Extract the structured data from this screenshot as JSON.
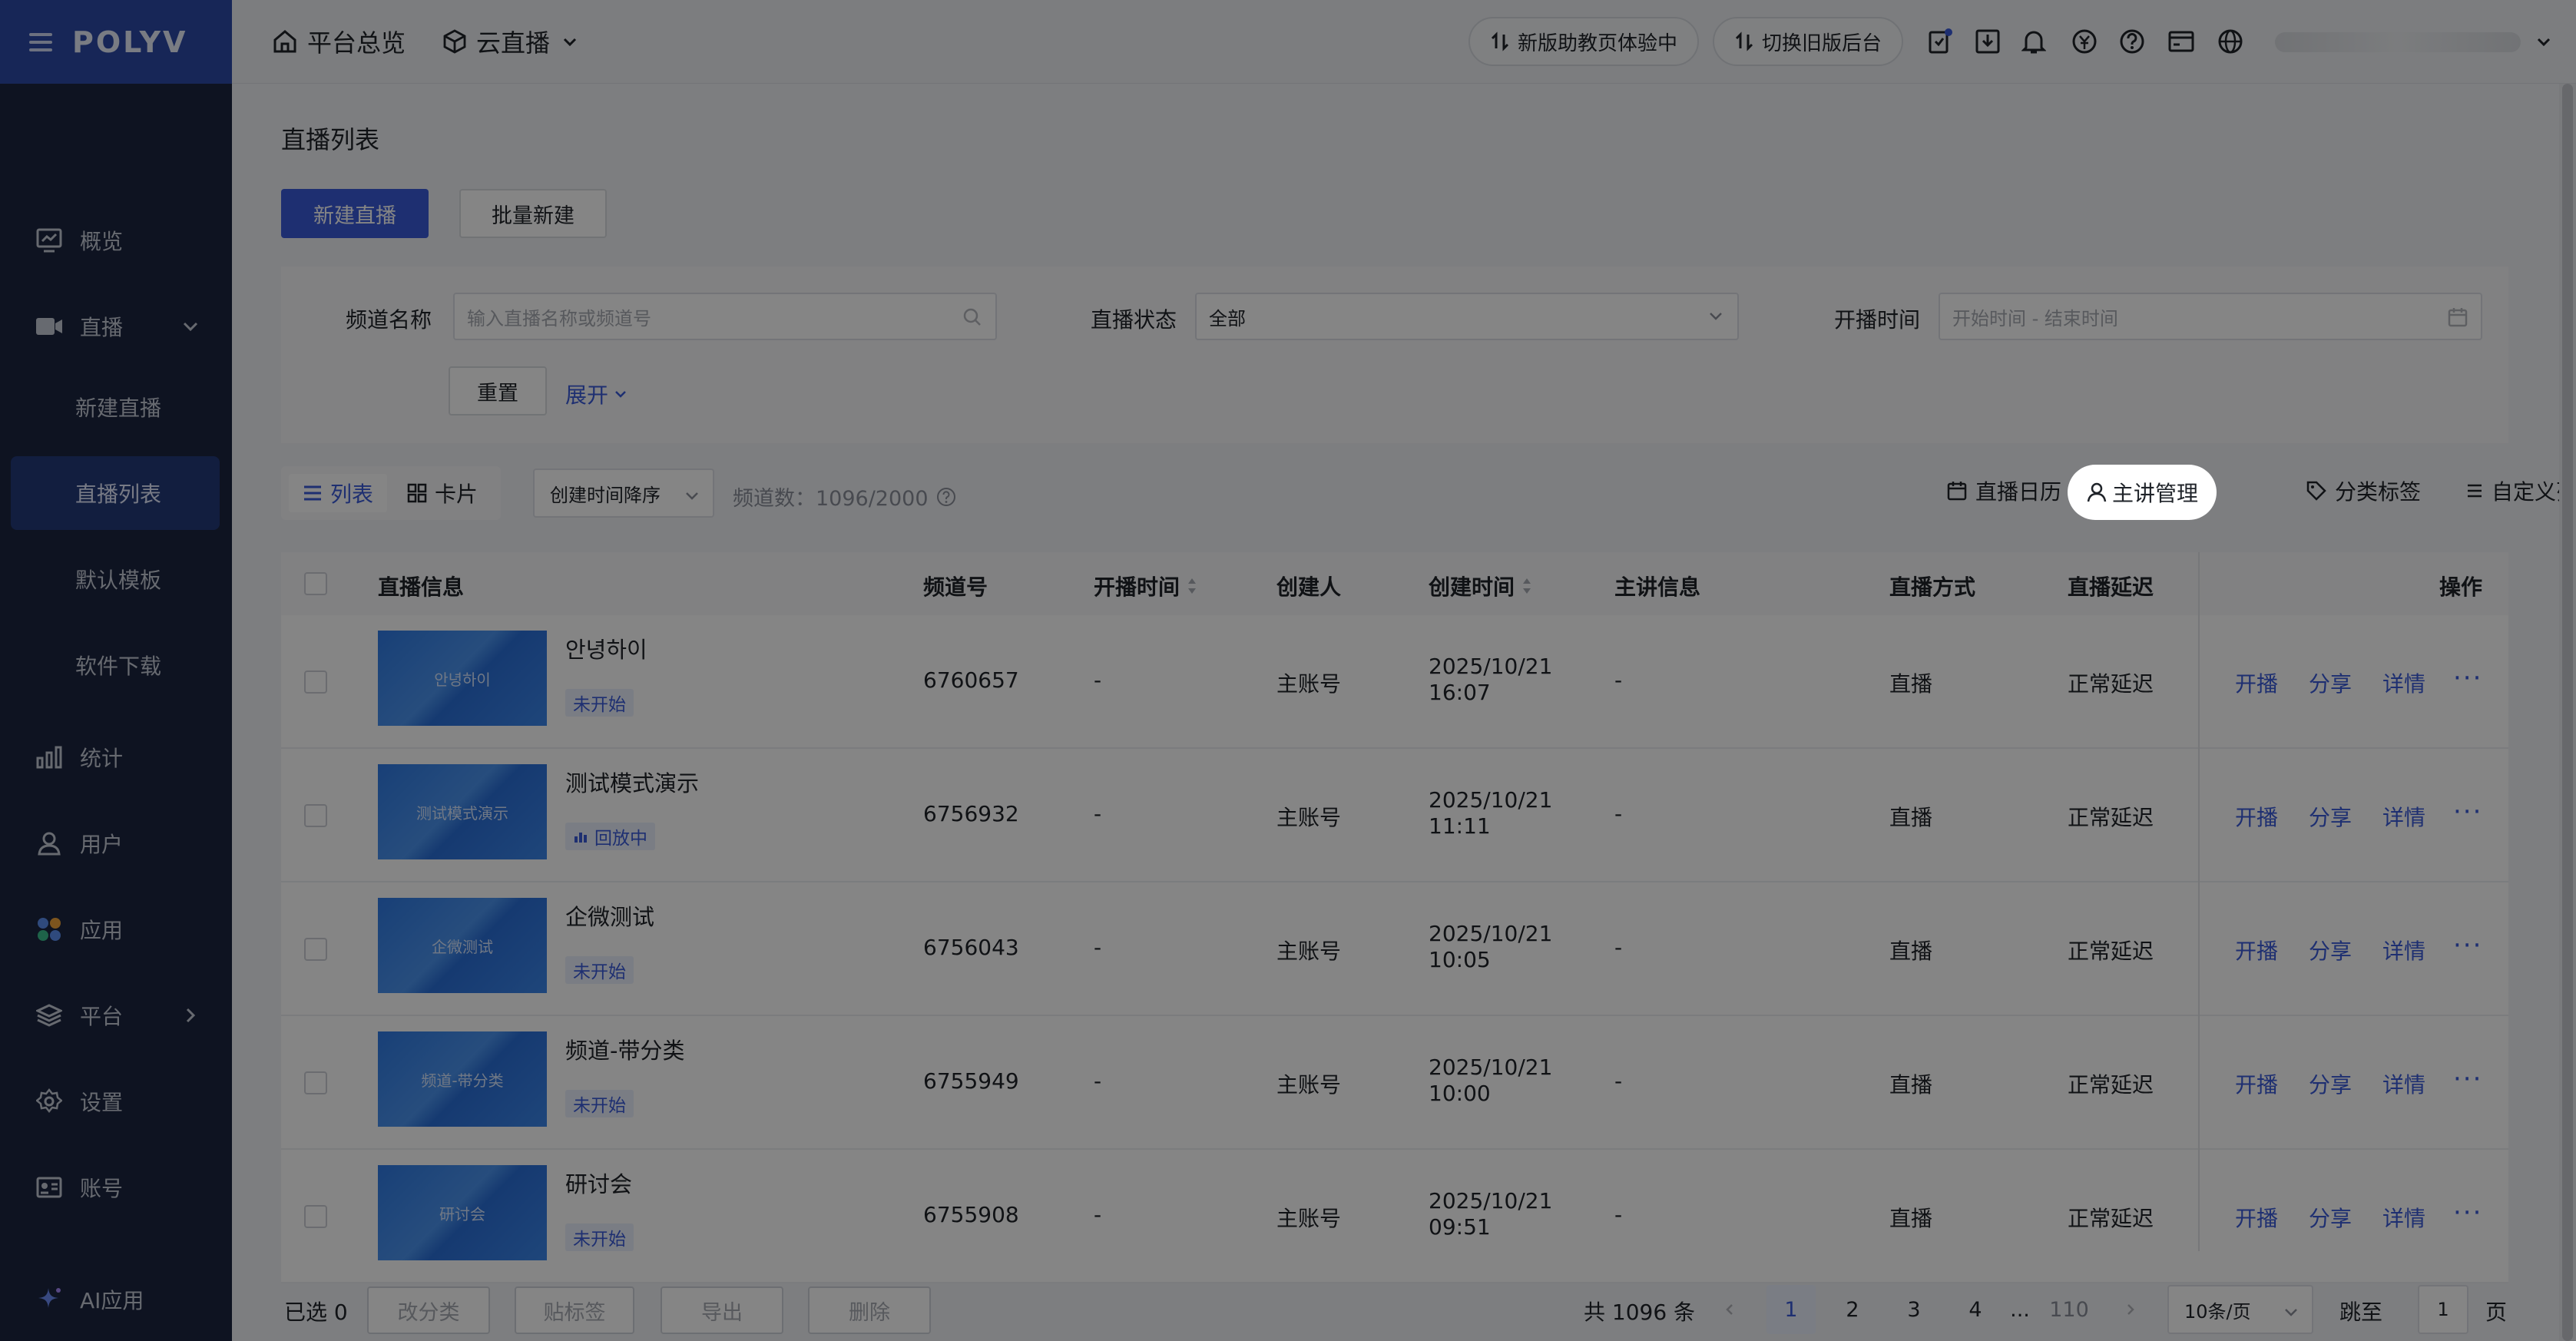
{
  "app": {
    "logo": "POLYV"
  },
  "sidebar": {
    "items": [
      {
        "label": "概览",
        "icon": "monitor-chart-icon"
      },
      {
        "label": "直播",
        "icon": "video-camera-icon",
        "expanded": true
      },
      {
        "label": "新建直播",
        "sub": true
      },
      {
        "label": "直播列表",
        "sub": true,
        "active": true
      },
      {
        "label": "默认模板",
        "sub": true
      },
      {
        "label": "软件下载",
        "sub": true
      },
      {
        "label": "统计",
        "icon": "bar-chart-icon"
      },
      {
        "label": "用户",
        "icon": "user-icon"
      },
      {
        "label": "应用",
        "icon": "apps-icon"
      },
      {
        "label": "平台",
        "icon": "layers-icon",
        "has_children": true
      },
      {
        "label": "设置",
        "icon": "gear-icon"
      },
      {
        "label": "账号",
        "icon": "id-card-icon"
      },
      {
        "label": "AI应用",
        "icon": "sparkle-icon"
      }
    ]
  },
  "topbar": {
    "home_label": "平台总览",
    "product_label": "云直播",
    "pill_new_assistant": "新版助教页体验中",
    "pill_switch_old": "切换旧版后台"
  },
  "page": {
    "title": "直播列表",
    "btn_new": "新建直播",
    "btn_batch": "批量新建"
  },
  "filters": {
    "channel_label": "频道名称",
    "channel_placeholder": "输入直播名称或频道号",
    "status_label": "直播状态",
    "status_value": "全部",
    "time_label": "开播时间",
    "time_placeholder": "开始时间 - 结束时间",
    "reset": "重置",
    "expand": "展开"
  },
  "toolbar": {
    "view_list": "列表",
    "view_card": "卡片",
    "sort_value": "创建时间降序",
    "channel_count": "频道数：1096/2000",
    "calendar": "直播日历",
    "speaker_mgmt": "主讲管理",
    "category_tags": "分类标签",
    "custom_list": "自定义列表"
  },
  "table": {
    "headers": {
      "info": "直播信息",
      "channel_no": "频道号",
      "start_time": "开播时间",
      "creator": "创建人",
      "created_time": "创建时间",
      "speaker": "主讲信息",
      "mode": "直播方式",
      "latency": "直播延迟",
      "ops": "操作"
    },
    "ops_labels": {
      "start": "开播",
      "share": "分享",
      "detail": "详情",
      "more": "···"
    },
    "rows": [
      {
        "thumb": "안녕하이",
        "title": "안녕하이",
        "status": "未开始",
        "channel": "6760657",
        "start": "-",
        "creator": "主账号",
        "date": "2025/10/21",
        "time": "16:07",
        "speaker": "-",
        "mode": "直播",
        "latency": "正常延迟"
      },
      {
        "thumb": "测试模式演示",
        "title": "测试模式演示",
        "status": "回放中",
        "channel": "6756932",
        "start": "-",
        "creator": "主账号",
        "date": "2025/10/21",
        "time": "11:11",
        "speaker": "-",
        "mode": "直播",
        "latency": "正常延迟"
      },
      {
        "thumb": "企微测试",
        "title": "企微测试",
        "status": "未开始",
        "channel": "6756043",
        "start": "-",
        "creator": "主账号",
        "date": "2025/10/21",
        "time": "10:05",
        "speaker": "-",
        "mode": "直播",
        "latency": "正常延迟"
      },
      {
        "thumb": "频道-带分类",
        "title": "频道-带分类",
        "status": "未开始",
        "channel": "6755949",
        "start": "-",
        "creator": "主账号",
        "date": "2025/10/21",
        "time": "10:00",
        "speaker": "-",
        "mode": "直播",
        "latency": "正常延迟"
      },
      {
        "thumb": "研讨会",
        "title": "研讨会",
        "status": "未开始",
        "channel": "6755908",
        "start": "-",
        "creator": "主账号",
        "date": "2025/10/21",
        "time": "09:51",
        "speaker": "-",
        "mode": "直播",
        "latency": "正常延迟"
      }
    ]
  },
  "footer": {
    "selected": "已选 0",
    "btn_recategorize": "改分类",
    "btn_tag": "贴标签",
    "btn_export": "导出",
    "btn_delete": "删除",
    "total": "共 1096 条",
    "pages": [
      "1",
      "2",
      "3",
      "4",
      "...",
      "110"
    ],
    "page_size": "10条/页",
    "jump_label": "跳至",
    "jump_value": "1",
    "page_suffix": "页"
  },
  "colors": {
    "primary": "#3a5bd9",
    "sidebar_bg": "#1b2540",
    "logo_bg": "#2d4aa8"
  }
}
